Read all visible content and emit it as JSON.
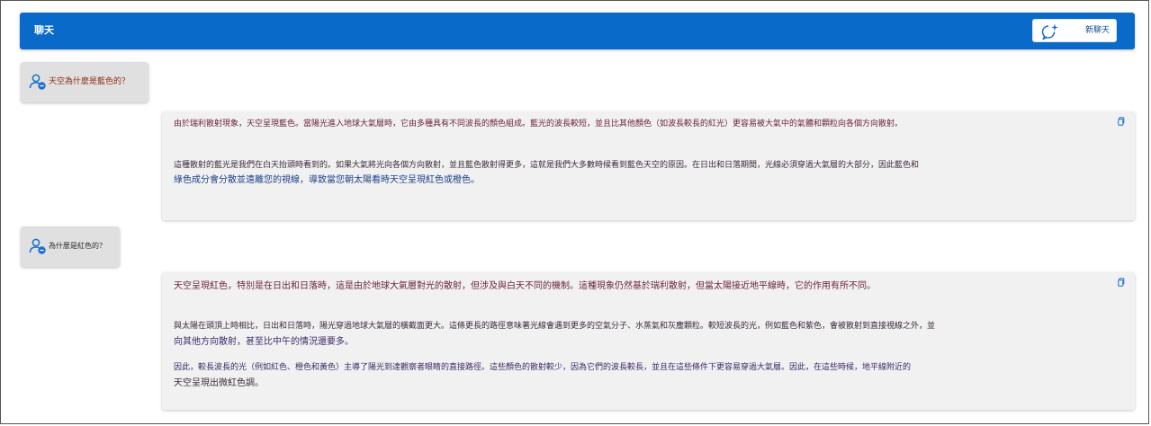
{
  "header": {
    "title": "聊天",
    "new_chat_label": "新聊天"
  },
  "messages": [
    {
      "role": "user",
      "text": "天空為什麼是藍色的？",
      "icon": "user-icon"
    },
    {
      "role": "assistant",
      "icon": "copy-icon",
      "paragraphs": [
        "由於瑞利散射現象，天空呈現藍色。當陽光進入地球大氣層時，它由多種具有不同波長的顏色組成。藍光的波長較短，並且比其他顏色（如波長較長的紅光）更容易被大氣中的氣體和顆粒向各個方向散射。",
        "這種散射的藍光是我們在白天抬頭時看到的。如果大氣將光向各個方向散射，並且藍色散射得更多，這就是我們大多數時候看到藍色天空的原因。在日出和日落期間，光線必須穿過大氣層的大部分，因此藍色和",
        "綠色成分會分散並遠離您的視線，導致當您朝太陽看時天空呈現紅色或橙色。"
      ]
    },
    {
      "role": "user",
      "text": "為什麼是紅色的？",
      "icon": "user-icon"
    },
    {
      "role": "assistant",
      "icon": "copy-icon",
      "paragraphs": [
        "天空呈現紅色，特別是在日出和日落時，這是由於地球大氣層對光的散射，但涉及與白天不同的機制。這種現象仍然基於瑞利散射，但當太陽接近地平線時，它的作用有所不同。",
        "與太陽在頭頂上時相比，日出和日落時，陽光穿過地球大氣層的橫截面更大。這條更長的路徑意味著光線會遇到更多的空氣分子、水蒸氣和灰塵顆粒。較短波長的光，例如藍色和紫色，會被散射到直接視線之外，並",
        "向其他方向散射，甚至比中午的情況還要多。",
        "因此，較長波長的光（例如紅色、橙色和黃色）主導了陽光到達觀察者眼睛的直接路徑。這些顏色的散射較少，因為它們的波長較長，並且在這些條件下更容易穿過大氣層。因此，在這些時候，地平線附近的",
        "天空呈現出微紅色調。"
      ]
    }
  ],
  "colors": {
    "header_bg": "#0a6ac9",
    "user_bubble_bg": "#e0e0e0",
    "reply_bg": "#f1f1f1",
    "accent_icon": "#1a6fd0"
  }
}
